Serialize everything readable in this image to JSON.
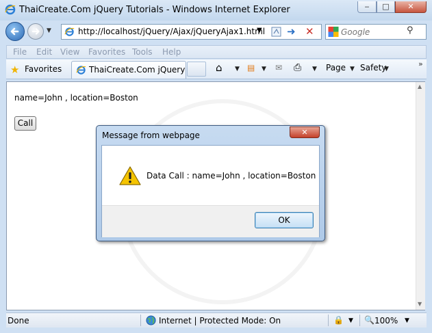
{
  "window": {
    "title": "ThaiCreate.Com jQuery Tutorials - Windows Internet Explorer",
    "minimize_glyph": "‒",
    "maximize_glyph": "□",
    "close_glyph": "✕"
  },
  "address": {
    "url": "http://localhost/jQuery/Ajax/jQueryAjax1.html",
    "dropdown_glyph": "▼",
    "go_glyph": "➜",
    "stop_glyph": "✕"
  },
  "search": {
    "placeholder": "Google",
    "button_glyph": "⚲"
  },
  "menu": [
    "File",
    "Edit",
    "View",
    "Favorites",
    "Tools",
    "Help"
  ],
  "favorites": {
    "label": "Favorites",
    "star_glyph": "★"
  },
  "tab": {
    "label": "ThaiCreate.Com jQuery ..."
  },
  "commands": {
    "page": "Page",
    "safety": "Safety",
    "dropdown_glyph": "▼",
    "chevron_glyph": "»",
    "home_glyph": "⌂",
    "feeds_glyph": "▤",
    "mail_glyph": "✉",
    "print_glyph": "⎙"
  },
  "page": {
    "text": "name=John , location=Boston",
    "call_button": "Call"
  },
  "dialog": {
    "title": "Message from webpage",
    "close_glyph": "✕",
    "message": "Data Call : name=John , location=Boston",
    "ok_button": "OK"
  },
  "status": {
    "done": "Done",
    "zone": "Internet | Protected Mode: On",
    "zoom": "100%",
    "lock_glyph": "🔒",
    "zoom_glyph": "🔍",
    "dropdown_glyph": "▼"
  },
  "scroll": {
    "up_glyph": "▲",
    "down_glyph": "▼"
  },
  "colors": {
    "chrome": "#cfe0f3",
    "accent_blue": "#2c69b4",
    "close_red": "#c4412a",
    "warning_yellow": "#f5c400"
  },
  "icons": {
    "browser": "ie-icon",
    "warning": "warning-icon",
    "globe": "globe-icon"
  }
}
